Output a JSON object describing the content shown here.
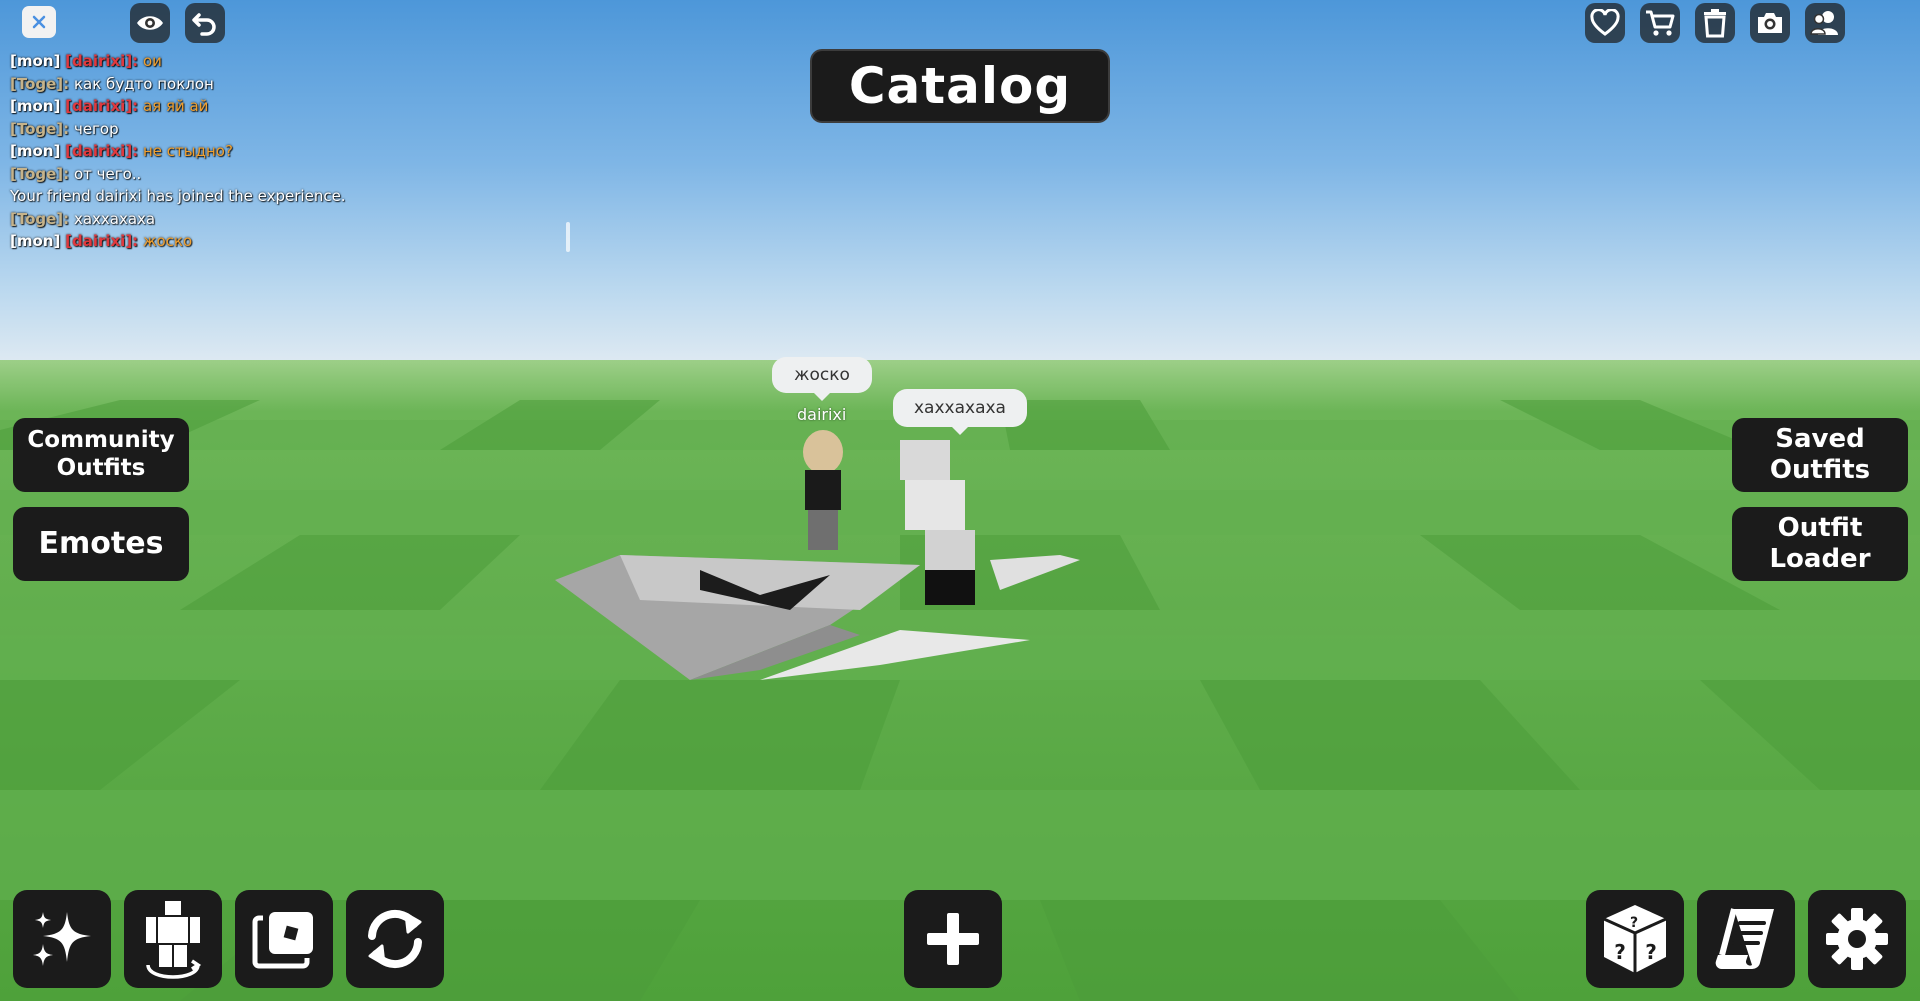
{
  "chat": {
    "lines": [
      {
        "tag": "[mon]",
        "name": "[dairixi]:",
        "message": "ои",
        "tag_color": "#ffffff",
        "name_color": "#e0393e",
        "message_color": "#f0a030"
      },
      {
        "tag": "",
        "name": "[Toge]:",
        "message": "как будто поклон",
        "tag_color": "#ffffff",
        "name_color": "#c6b38a",
        "message_color": "#ffffff"
      },
      {
        "tag": "[mon]",
        "name": "[dairixi]:",
        "message": "ая яй ай",
        "tag_color": "#ffffff",
        "name_color": "#e0393e",
        "message_color": "#f0a030"
      },
      {
        "tag": "",
        "name": "[Toge]:",
        "message": "чегор",
        "tag_color": "#ffffff",
        "name_color": "#c6b38a",
        "message_color": "#ffffff"
      },
      {
        "tag": "[mon]",
        "name": "[dairixi]:",
        "message": "не стыдно?",
        "tag_color": "#ffffff",
        "name_color": "#e0393e",
        "message_color": "#f0a030"
      },
      {
        "tag": "",
        "name": "[Toge]:",
        "message": "от чего..",
        "tag_color": "#ffffff",
        "name_color": "#c6b38a",
        "message_color": "#ffffff"
      },
      {
        "tag": "",
        "name": "",
        "message": "Your friend dairixi has joined the experience.",
        "tag_color": "#ffffff",
        "name_color": "#ffffff",
        "message_color": "#ffffff"
      },
      {
        "tag": "",
        "name": "[Toge]:",
        "message": "хаххахаха",
        "tag_color": "#ffffff",
        "name_color": "#c6b38a",
        "message_color": "#ffffff"
      },
      {
        "tag": "[mon]",
        "name": "[dairixi]:",
        "message": "жоско",
        "tag_color": "#ffffff",
        "name_color": "#e0393e",
        "message_color": "#f0a030"
      }
    ]
  },
  "top_left_icons": [
    {
      "name": "close-icon"
    },
    {
      "name": "eye-icon"
    },
    {
      "name": "undo-icon"
    }
  ],
  "top_right_icons": [
    {
      "name": "heart-icon"
    },
    {
      "name": "cart-icon"
    },
    {
      "name": "trash-icon"
    },
    {
      "name": "camera-icon"
    },
    {
      "name": "people-icon"
    }
  ],
  "title": "Catalog",
  "left_buttons": {
    "community_outfits": "Community Outfits",
    "emotes": "Emotes"
  },
  "right_buttons": {
    "saved_outfits": "Saved Outfits",
    "outfit_loader": "Outfit Loader"
  },
  "bottom_left_tools": [
    {
      "name": "sparkles-icon"
    },
    {
      "name": "avatar-icon"
    },
    {
      "name": "catalog-pages-icon"
    },
    {
      "name": "refresh-icon"
    }
  ],
  "bottom_center_tool": {
    "name": "plus-icon"
  },
  "bottom_right_tools": [
    {
      "name": "random-dice-icon"
    },
    {
      "name": "receipt-icon"
    },
    {
      "name": "settings-gear-icon"
    }
  ],
  "bubbles": {
    "left_bubble": "жоско",
    "right_bubble": "хаххахаха",
    "left_nametag": "dairixi"
  },
  "colors": {
    "button_bg": "#1b1b1b",
    "sky_top": "#4d97d9",
    "ground": "#5aa845"
  }
}
